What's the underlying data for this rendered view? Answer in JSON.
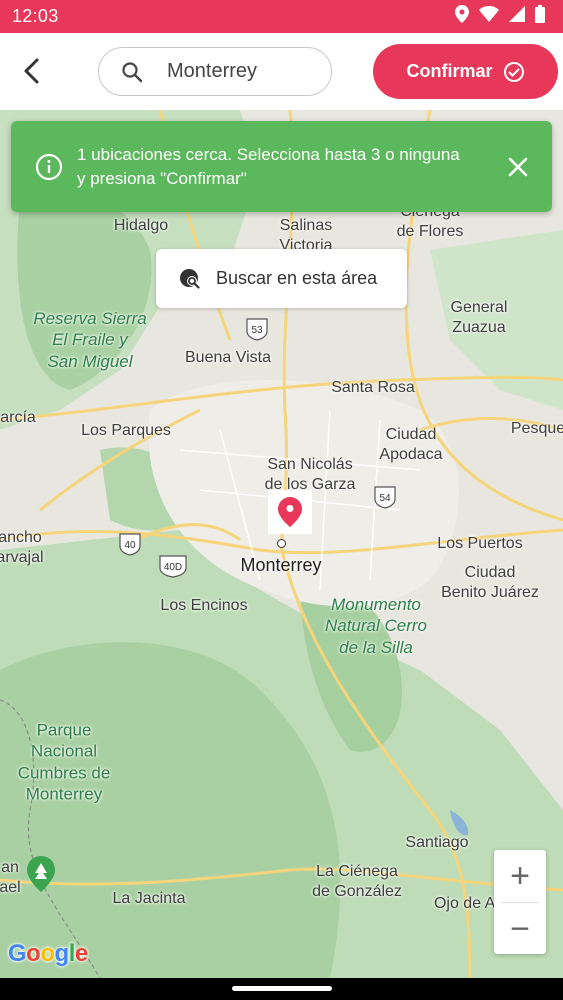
{
  "status_bar": {
    "time": "12:03",
    "icons": [
      "location-icon",
      "wifi-icon",
      "signal-icon",
      "battery-icon"
    ]
  },
  "header": {
    "search_value": "Monterrey",
    "confirm_label": "Confirmar"
  },
  "banner": {
    "message": "1 ubicaciones cerca. Selecciona hasta 3 o ninguna y presiona \"Confirmar\""
  },
  "map": {
    "area_search_label": "Buscar en esta área",
    "labels": {
      "hidalgo": "Hidalgo",
      "salinas_victoria": "Salinas\nVictoria",
      "cienega_flores": "Ciénega\nde Flores",
      "reserva": "Reserva Sierra\nEl Fraile y\nSan Miguel",
      "buena_vista": "Buena Vista",
      "general_zuazua": "General\nZuazua",
      "santa_rosa": "Santa Rosa",
      "garcia": "arcía",
      "los_parques": "Los Parques",
      "ciudad_apodaca": "Ciudad\nApodaca",
      "pesqueria": "Pesque",
      "san_nicolas": "San Nicolás\nde los Garza",
      "rancho_carvajal": "ancho\narvajal",
      "monterrey": "Monterrey",
      "los_puertos": "Los Puertos",
      "ciudad_benito": "Ciudad\nBenito Juárez",
      "los_encinos": "Los Encinos",
      "monumento": "Monumento\nNatural Cerro\nde la Silla",
      "parque_cumbres": "Parque\nNacional\nCumbres de\nMonterrey",
      "santiago": "Santiago",
      "la_cienega": "La Ciénega\nde González",
      "ojo_de_agua": "Ojo de Agua",
      "la_jacinta": "La Jacinta",
      "san_rafael": "an\nael"
    },
    "shields": {
      "r53": "53",
      "r54": "54",
      "r40": "40",
      "r40d": "40D"
    },
    "zoom_in": "+",
    "zoom_out": "−",
    "attribution": "Google"
  },
  "colors": {
    "brand": "#e8385a",
    "success": "#5cb85c",
    "map_green": "#b8d9b3",
    "road": "#f7d680"
  }
}
